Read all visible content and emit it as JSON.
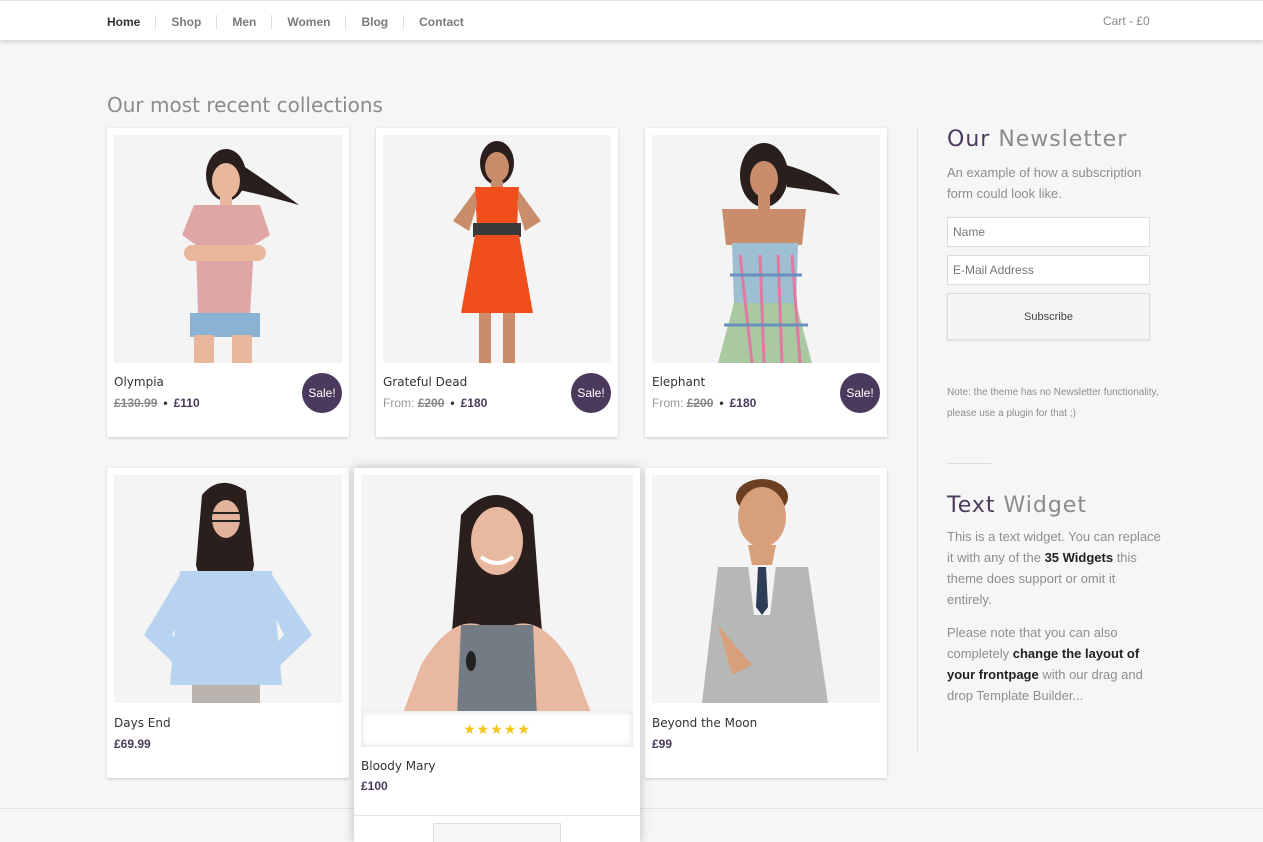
{
  "nav": {
    "items": [
      {
        "label": "Home"
      },
      {
        "label": "Shop"
      },
      {
        "label": "Men"
      },
      {
        "label": "Women"
      },
      {
        "label": "Blog"
      },
      {
        "label": "Contact"
      }
    ],
    "cart": "Cart - £0"
  },
  "main": {
    "title": "Our most recent collections",
    "products": [
      {
        "name": "Olympia",
        "from": "",
        "old_price": "£130.99",
        "price": "£110",
        "sale": "Sale!"
      },
      {
        "name": "Grateful Dead",
        "from": "From:",
        "old_price": "£200",
        "price": "£180",
        "sale": "Sale!"
      },
      {
        "name": "Elephant",
        "from": "From:",
        "old_price": "£200",
        "price": "£180",
        "sale": "Sale!"
      },
      {
        "name": "Days End",
        "price": "£69.99"
      },
      {
        "name": "Bloody Mary",
        "price": "£100",
        "rating": "★★★★★"
      },
      {
        "name": "Beyond the Moon",
        "price": "£99"
      }
    ]
  },
  "sidebar": {
    "newsletter": {
      "title_strong": "Our",
      "title_light": "Newsletter",
      "desc": "An example of how a subscription form could look like.",
      "name_placeholder": "Name",
      "email_placeholder": "E-Mail Address",
      "button": "Subscribe",
      "note": "Note: the theme has no Newsletter functionality, please use a plugin for that ;)"
    },
    "text_widget": {
      "title_strong": "Text",
      "title_light": "Widget",
      "p1_a": "This is a text widget. You can replace it with any of the ",
      "p1_b": "35 Widgets",
      "p1_c": " this theme does support or omit it entirely.",
      "p2_a": "Please note that you can also completely ",
      "p2_b": "change the layout of your frontpage",
      "p2_c": " with our drag and drop Template Builder..."
    }
  },
  "colors": {
    "accent": "#4b3a5e",
    "star": "#f5c518"
  }
}
